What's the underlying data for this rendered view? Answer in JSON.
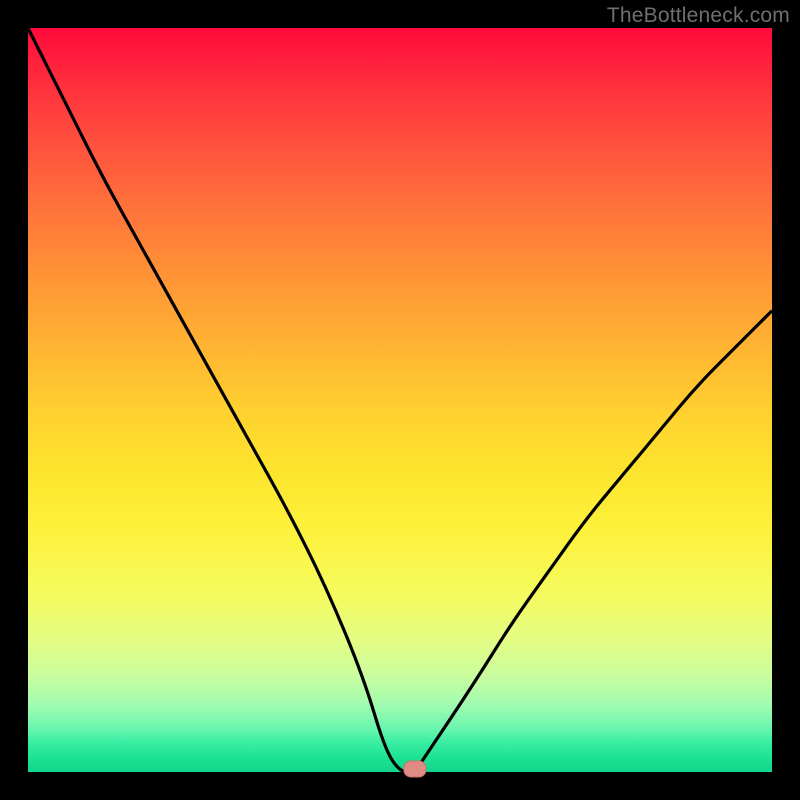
{
  "watermark": "TheBottleneck.com",
  "chart_data": {
    "type": "line",
    "title": "",
    "xlabel": "",
    "ylabel": "",
    "xlim": [
      0,
      100
    ],
    "ylim": [
      0,
      100
    ],
    "legend": false,
    "grid": false,
    "background_gradient": {
      "top": "#ff0a3c",
      "bottom": "#11d68c",
      "stops": [
        "red",
        "orange",
        "yellow",
        "green"
      ]
    },
    "series": [
      {
        "name": "bottleneck-curve",
        "color": "#000000",
        "x": [
          0,
          5,
          10,
          15,
          20,
          25,
          30,
          35,
          40,
          45,
          48,
          50,
          52,
          54,
          60,
          65,
          70,
          75,
          80,
          85,
          90,
          95,
          100
        ],
        "y": [
          100,
          90,
          80,
          71,
          62,
          53,
          44,
          35,
          25,
          13,
          3,
          0,
          0,
          3,
          12,
          20,
          27,
          34,
          40,
          46,
          52,
          57,
          62
        ]
      }
    ],
    "marker": {
      "name": "optimum-point",
      "x": 52,
      "y": 0,
      "color": "#e08b84",
      "shape": "rounded-rect"
    }
  }
}
